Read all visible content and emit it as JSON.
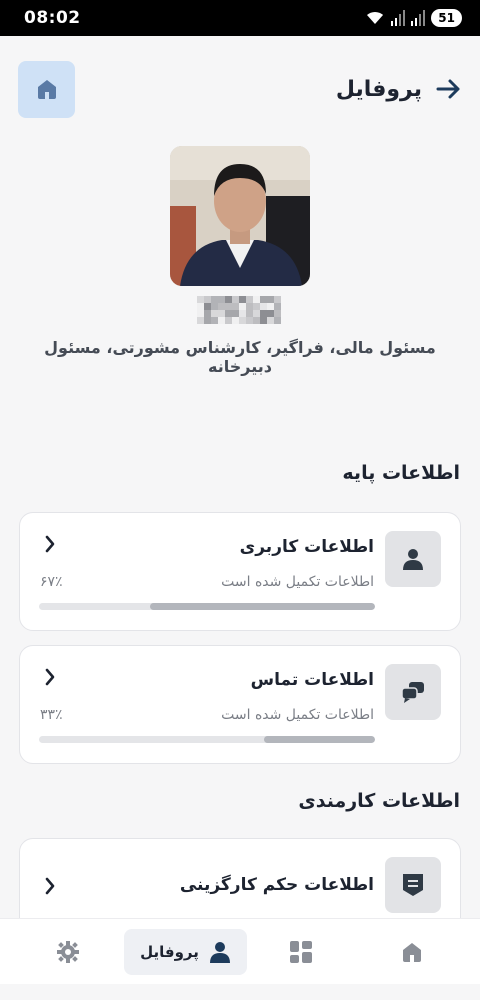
{
  "status_bar": {
    "time": "08:02",
    "battery": "51"
  },
  "header": {
    "title": "پروفایل"
  },
  "profile": {
    "roles": "مسئول مالی، فراگیر، کارشناس مشورتی، مسئول دبیرخانه"
  },
  "sections": {
    "basic": {
      "title": "اطلاعات پایه",
      "cards": [
        {
          "title": "اطلاعات کاربری",
          "subtitle": "اطلاعات تکمیل شده است",
          "percent_label": "۶۷٪",
          "progress": 0.67
        },
        {
          "title": "اطلاعات تماس",
          "subtitle": "اطلاعات تکمیل شده است",
          "percent_label": "۳۳٪",
          "progress": 0.33
        }
      ]
    },
    "employee": {
      "title": "اطلاعات کارمندی",
      "cards": [
        {
          "title": "اطلاعات حکم کارگزینی"
        }
      ]
    }
  },
  "bottom_nav": {
    "profile_label": "پروفایل"
  },
  "colors": {
    "accent": "#1d3b5c",
    "home_tile": "#cfe1f6",
    "icon_tile": "#e2e3e6"
  }
}
